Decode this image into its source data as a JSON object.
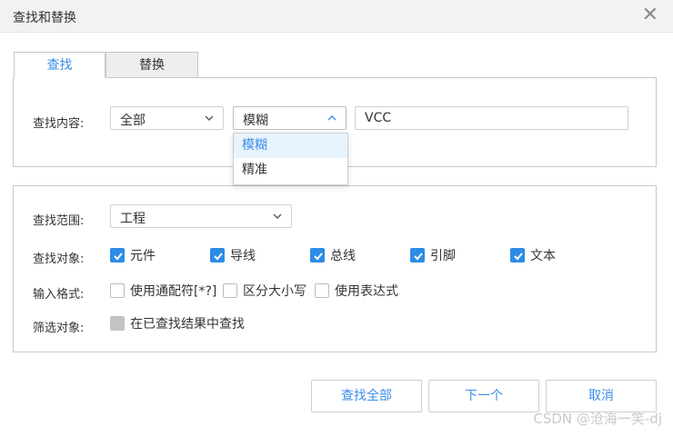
{
  "dialog": {
    "title": "查找和替换",
    "close_icon": "close-icon"
  },
  "tabs": [
    {
      "label": "查找",
      "active": true
    },
    {
      "label": "替换",
      "active": false
    }
  ],
  "find": {
    "content_label": "查找内容:",
    "scope_select": "全部",
    "mode_select": "模糊",
    "mode_options": [
      "模糊",
      "精准"
    ],
    "mode_highlighted": "模糊",
    "search_value": "VCC"
  },
  "options": {
    "range_label": "查找范围:",
    "range_value": "工程",
    "objects_label": "查找对象:",
    "objects": [
      {
        "label": "元件",
        "checked": true
      },
      {
        "label": "导线",
        "checked": true
      },
      {
        "label": "总线",
        "checked": true
      },
      {
        "label": "引脚",
        "checked": true
      },
      {
        "label": "文本",
        "checked": true
      }
    ],
    "format_label": "输入格式:",
    "formats": [
      {
        "label": "使用通配符[*?]",
        "checked": false
      },
      {
        "label": "区分大小写",
        "checked": false
      },
      {
        "label": "使用表达式",
        "checked": false
      }
    ],
    "filter_label": "筛选对象:",
    "filter": {
      "label": "在已查找结果中查找",
      "checked": false,
      "disabled": true
    }
  },
  "buttons": {
    "find_all": "查找全部",
    "next": "下一个",
    "cancel": "取消"
  },
  "watermark": "CSDN @沧海一笑-dj",
  "colors": {
    "accent": "#3a8ee6",
    "checkbox": "#2d8ce6",
    "disabled": "#c3c3c3"
  }
}
